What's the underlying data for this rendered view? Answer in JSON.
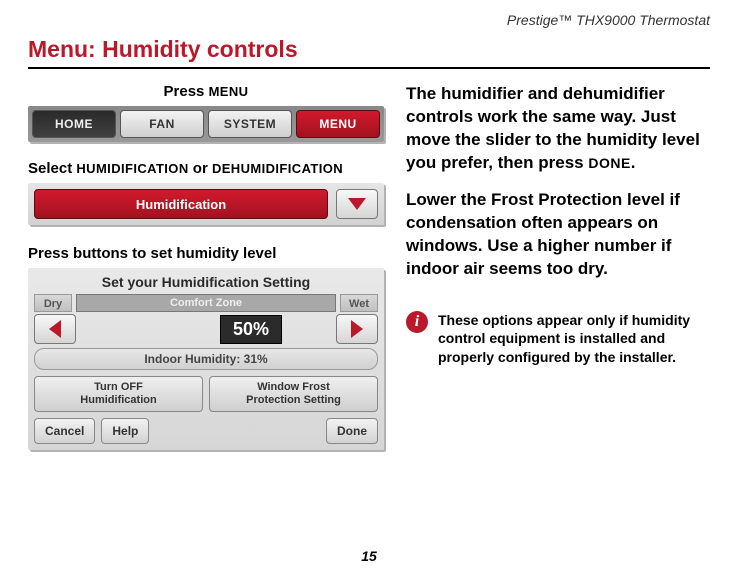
{
  "header": "Prestige™ THX9000 Thermostat",
  "title": "Menu: Humidity controls",
  "page_number": "15",
  "instructions": {
    "press_menu_prefix": "Press ",
    "press_menu_label": "MENU",
    "select_prefix": "Select ",
    "select_or": " or ",
    "select_hum": "HUMIDIFICATION",
    "select_dehum": "DEHUMIDIFICATION",
    "press_buttons": "Press buttons to set humidity level"
  },
  "tabbar": {
    "home": "HOME",
    "fan": "FAN",
    "system": "SYSTEM",
    "menu": "MENU"
  },
  "humidification_pill": "Humidification",
  "humidity_screen": {
    "title": "Set your Humidification Setting",
    "dry": "Dry",
    "wet": "Wet",
    "comfort_zone": "Comfort Zone",
    "value": "50%",
    "indoor": "Indoor Humidity: 31%",
    "turn_off_l1": "Turn OFF",
    "turn_off_l2": "Humidification",
    "frost_l1": "Window Frost",
    "frost_l2": "Protection Setting",
    "cancel": "Cancel",
    "help": "Help",
    "done": "Done"
  },
  "right": {
    "p1a": "The humidifier and dehumidifier controls work the same way. Just move the slider to the humidity level you prefer, then press ",
    "p1_done": "DONE",
    "p1b": ".",
    "p2": "Lower the Frost Protection level if condensation often appears on windows. Use a higher number if indoor air seems too dry.",
    "info": "These options appear only if humidity control equipment is installed and properly configured by the installer."
  }
}
